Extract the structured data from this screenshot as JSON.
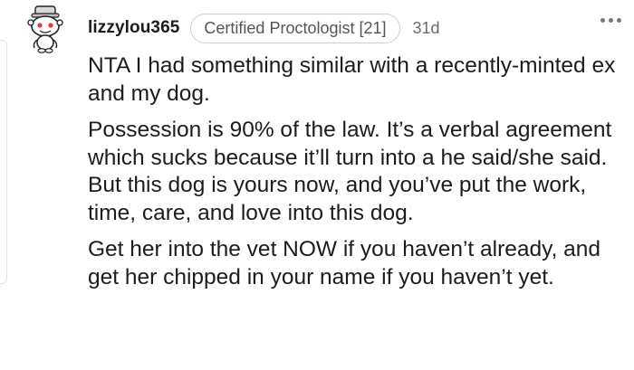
{
  "comment": {
    "username": "lizzylou365",
    "flair": "Certified Proctologist [21]",
    "age": "31d",
    "avatar_icon": "snoo-avatar-icon",
    "more_icon": "more-options-icon",
    "paragraphs": [
      "NTA I had something similar with a recently-minted ex and my dog.",
      "Possession is 90% of the law. It’s a verbal agreement which sucks because it’ll turn into a he said/she said. But this dog is yours now, and you’ve put the work, time, care, and love into this dog.",
      "Get her into the vet NOW if you haven’t already, and get her chipped in your name if you haven’t yet."
    ]
  },
  "colors": {
    "text": "#1c1c1c",
    "meta": "#6b6b6b",
    "flair_border": "#cfcfcf"
  }
}
